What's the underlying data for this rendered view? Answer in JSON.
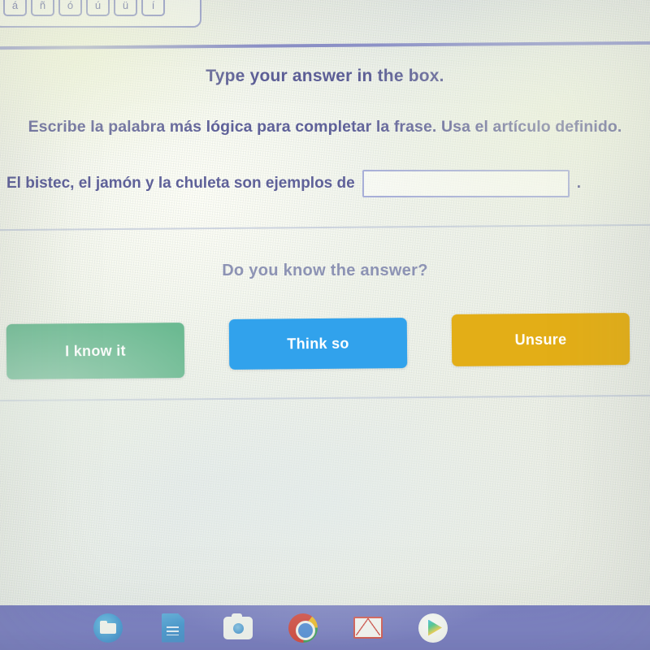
{
  "accent_strip": {
    "name": "accent-character-keys",
    "keys": [
      "á",
      "ñ",
      "ó",
      "ú",
      "ü",
      "í"
    ]
  },
  "lesson": {
    "heading": "Type your answer in the box.",
    "instruction": "Escribe la palabra más lógica para completar la frase. Usa el artículo definido.",
    "question_text": "El bistec, el jamón y la chuleta son ejemplos de",
    "question_period": ".",
    "answer_value": "",
    "answer_placeholder": ""
  },
  "confidence": {
    "prompt": "Do you know the answer?",
    "buttons": [
      {
        "label": "I know it",
        "color": "#6cba92",
        "name": "know-it"
      },
      {
        "label": "Think so",
        "color": "#31a2ec",
        "name": "think-so"
      },
      {
        "label": "Unsure",
        "color": "#e3ae17",
        "name": "unsure"
      }
    ]
  },
  "shelf": {
    "icons": [
      {
        "name": "files-icon",
        "label": "Files"
      },
      {
        "name": "google-docs-icon",
        "label": "Docs"
      },
      {
        "name": "camera-icon",
        "label": "Camera"
      },
      {
        "name": "chrome-icon",
        "label": "Chrome"
      },
      {
        "name": "gmail-icon",
        "label": "Gmail"
      },
      {
        "name": "play-store-icon",
        "label": "Play Store"
      }
    ],
    "background_color": "#7b80c2"
  },
  "theme": {
    "text_color": "#5f6199",
    "muted_text_color": "#8d93b4",
    "rule_strong_color": "#8288c6",
    "rule_light_color": "#b9c2d6",
    "page_background": "#eef0e8"
  }
}
